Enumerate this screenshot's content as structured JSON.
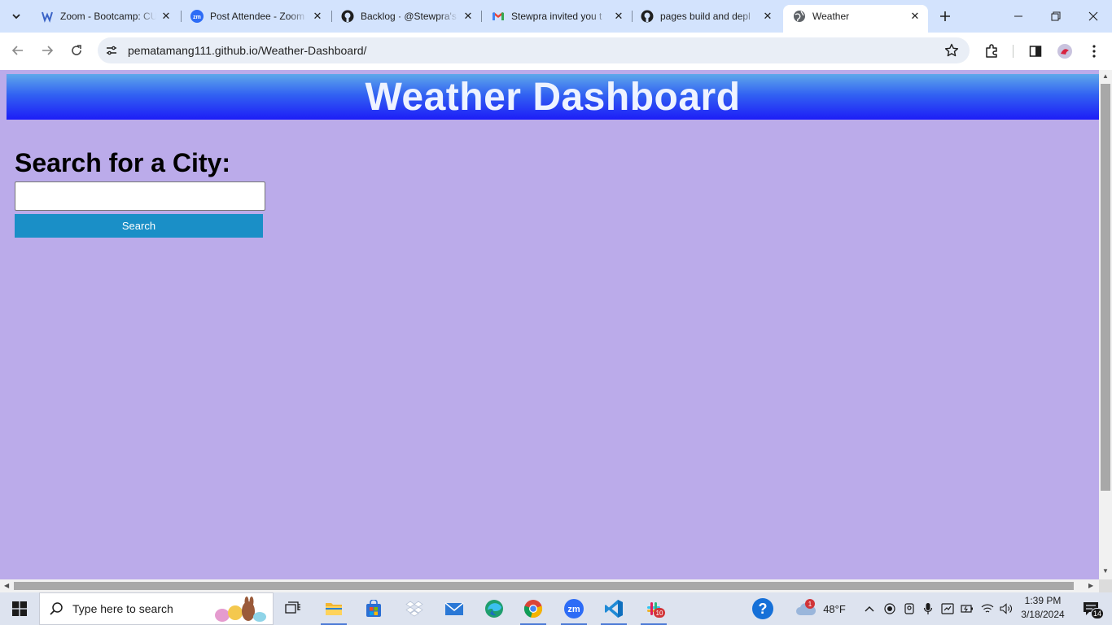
{
  "browser": {
    "tabs": [
      {
        "title": "Zoom - Bootcamp: CU",
        "icon": "zoom-bootcamp-icon"
      },
      {
        "title": "Post Attendee - Zoom",
        "icon": "zoom-icon"
      },
      {
        "title": "Backlog · @Stewpra's",
        "icon": "github-icon"
      },
      {
        "title": "Stewpra invited you t",
        "icon": "gmail-icon"
      },
      {
        "title": "pages build and depl",
        "icon": "github-icon"
      },
      {
        "title": "Weather",
        "icon": "globe-icon",
        "active": true
      }
    ],
    "url": "pematamang111.github.io/Weather-Dashboard/"
  },
  "page": {
    "title": "Weather Dashboard",
    "search_heading": "Search for a City:",
    "city_input_value": "",
    "search_button": "Search",
    "colors": {
      "background": "#bbabea",
      "header_top": "#5fa8ea",
      "header_bottom": "#1d1df7",
      "button": "#1a8fc7"
    }
  },
  "taskbar": {
    "search_placeholder": "Type here to search",
    "weather": "48°F",
    "weather_badge": "1",
    "slack_badge": "10",
    "notification_count": "14",
    "time": "1:39 PM",
    "date": "3/18/2024"
  }
}
